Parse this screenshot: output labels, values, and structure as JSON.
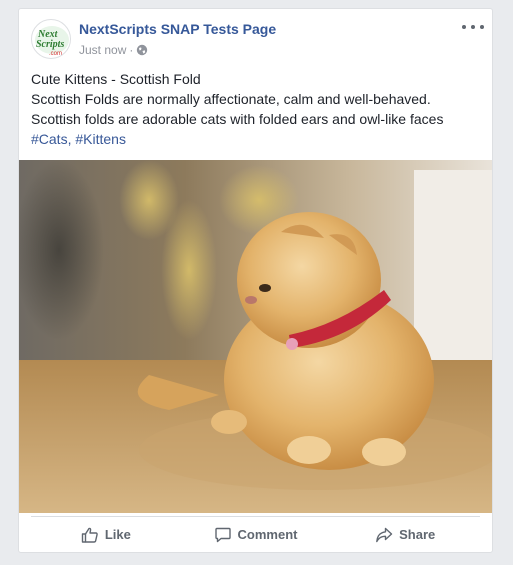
{
  "post": {
    "page_name": "NextScripts SNAP Tests Page",
    "timestamp": "Just now",
    "separator": "·",
    "avatar_logo_text": [
      "Next",
      "Scripts",
      ".com"
    ],
    "lines": [
      "Cute Kittens - Scottish Fold",
      "Scottish Folds are normally affectionate, calm and well-behaved.",
      "Scottish folds are adorable cats with folded ears and owl-like faces"
    ],
    "hashtags": [
      "#Cats",
      "#Kittens"
    ],
    "hashtag_separator": ", ",
    "image_subject": "orange scottish fold kitten with red collar on counter"
  },
  "actions": {
    "like": "Like",
    "comment": "Comment",
    "share": "Share"
  },
  "colors": {
    "link": "#365899",
    "text": "#1d2129",
    "muted": "#90949c",
    "action": "#606770",
    "logo_green": "#2e7d32",
    "logo_red": "#d32f2f"
  },
  "icons": [
    "more-options-icon",
    "globe-icon",
    "like-icon",
    "comment-icon",
    "share-icon"
  ]
}
